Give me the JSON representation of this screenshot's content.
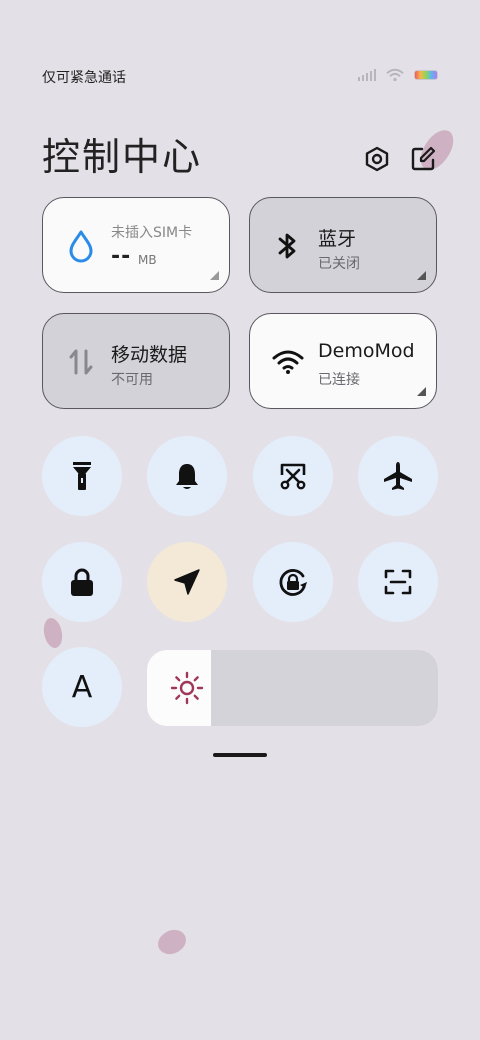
{
  "status_bar": {
    "carrier": "仅可紧急通话",
    "icons": [
      "signal-icon",
      "wifi-icon",
      "battery-icon"
    ]
  },
  "header": {
    "title": "控制中心",
    "settings_icon": "settings-hexagon-icon",
    "edit_icon": "edit-icon"
  },
  "tiles": {
    "data_usage": {
      "label": "未插入SIM卡",
      "value": "--",
      "unit": "MB",
      "icon": "water-drop-icon"
    },
    "bluetooth": {
      "label": "蓝牙",
      "status": "已关闭",
      "icon": "bluetooth-icon"
    },
    "mobile_data": {
      "label": "移动数据",
      "status": "不可用",
      "icon": "data-arrows-icon"
    },
    "wifi": {
      "label": "DemoMod",
      "status": "已连接",
      "icon": "wifi-icon"
    }
  },
  "toggles": [
    {
      "name": "flashlight",
      "icon": "flashlight-icon",
      "active": false
    },
    {
      "name": "ring",
      "icon": "bell-icon",
      "active": false
    },
    {
      "name": "screenshot",
      "icon": "scissors-screenshot-icon",
      "active": false
    },
    {
      "name": "airplane",
      "icon": "airplane-icon",
      "active": false
    },
    {
      "name": "lock-screen",
      "icon": "lock-icon",
      "active": false
    },
    {
      "name": "location",
      "icon": "location-arrow-icon",
      "active": true
    },
    {
      "name": "rotation-lock",
      "icon": "rotation-lock-icon",
      "active": false
    },
    {
      "name": "scanner",
      "icon": "scan-icon",
      "active": false
    }
  ],
  "font_toggle": {
    "letter": "A",
    "icon": "font-size-icon"
  },
  "brightness": {
    "level": 0.22,
    "icon": "sun-icon"
  },
  "colors": {
    "background": "#e3e1e7",
    "toggle_inactive": "#e4eefb",
    "toggle_active": "#f3e9d6",
    "accent_blue": "#2a8ce8",
    "sun": "#a0375a"
  }
}
